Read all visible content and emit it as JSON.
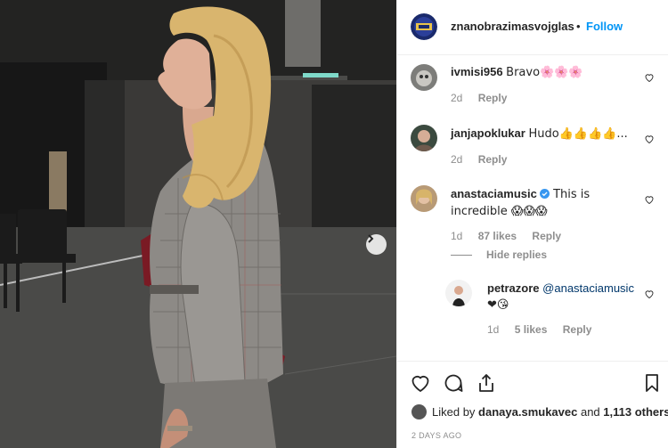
{
  "post": {
    "username": "znanobrazimasvojglas",
    "dot": "•",
    "follow_label": "Follow"
  },
  "comments": [
    {
      "username": "ivmisi956",
      "text": "Bravo🌸🌸🌸",
      "age": "2d",
      "reply_label": "Reply"
    },
    {
      "username": "janjapoklukar",
      "text": "Hudo👍👍👍👍...",
      "age": "2d",
      "reply_label": "Reply"
    },
    {
      "username": "anastaciamusic",
      "text": "This is incredible 😱😱😱",
      "age": "1d",
      "likes": "87 likes",
      "reply_label": "Reply",
      "hide_replies_label": "Hide replies"
    },
    {
      "username": "petrazore",
      "mention": "@anastaciamusic",
      "text": "❤😘",
      "age": "1d",
      "likes": "5 likes",
      "reply_label": "Reply"
    }
  ],
  "likes_summary": {
    "prefix": "Liked by",
    "user": "danaya.smukavec",
    "connector": "and",
    "others": "1,113 others"
  },
  "timestamp": "2 DAYS AGO",
  "colors": {
    "link": "#0095f6",
    "meta": "#8e8e8e",
    "text": "#262626",
    "border": "#efefef"
  }
}
